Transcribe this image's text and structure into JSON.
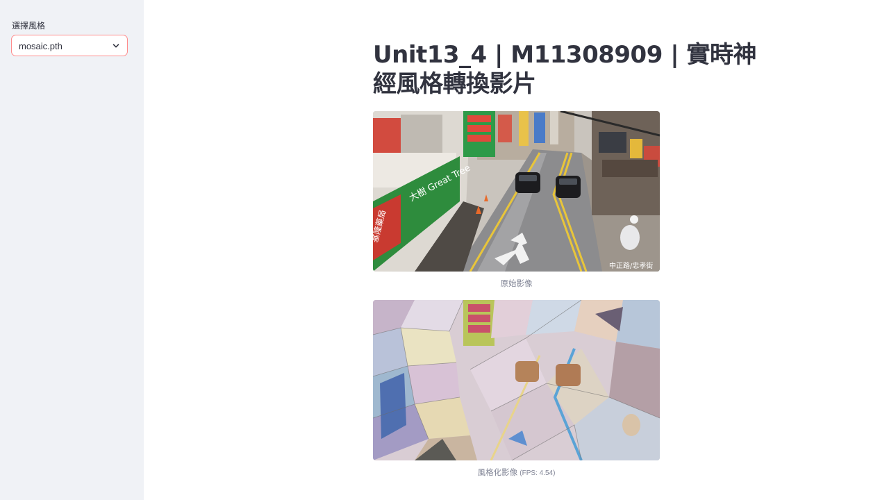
{
  "sidebar": {
    "style_select": {
      "label": "選擇風格",
      "value": "mosaic.pth"
    }
  },
  "main": {
    "title": "Unit13_4 | M11308909 | 實時神經風格轉換影片",
    "original": {
      "caption": "原始影像",
      "sign_text": "大樹 Great Tree",
      "pharmacy_text": "基隆藥局",
      "watermark": "中正路/忠孝街"
    },
    "styled": {
      "caption_prefix": "風格化影像",
      "caption_fps": "(FPS: 4.54)"
    }
  },
  "colors": {
    "sidebar_bg": "#f0f2f6",
    "select_border": "#ff8c8c",
    "text": "#31333f",
    "caption": "#808495"
  },
  "icons": {
    "dropdown": "chevron-down-icon"
  }
}
